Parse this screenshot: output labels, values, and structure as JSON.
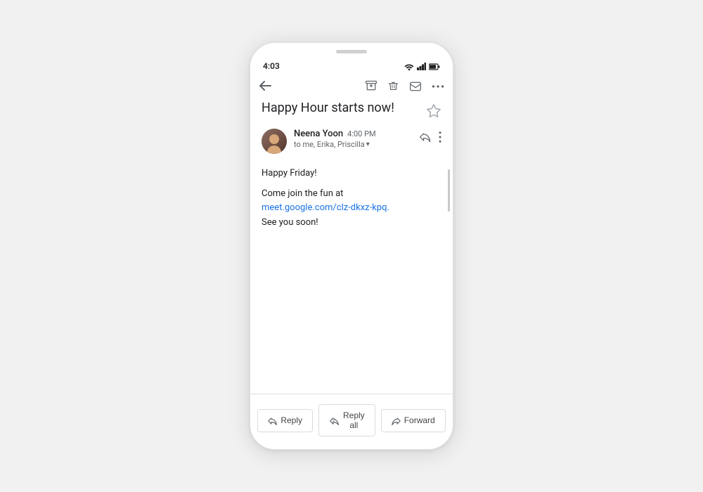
{
  "phone": {
    "status_bar": {
      "time": "4:03"
    },
    "toolbar": {
      "archive_label": "Archive",
      "delete_label": "Delete",
      "label_label": "Label",
      "more_label": "More"
    },
    "email": {
      "subject": "Happy Hour starts now!",
      "sender": {
        "name": "Neena Yoon",
        "time": "4:00 PM",
        "to": "to me, Erika, Priscilla"
      },
      "body_line1": "Happy Friday!",
      "body_line2": "Come join the fun at",
      "body_link": "meet.google.com/clz-dkxz-kpq.",
      "body_line3": "See you soon!"
    },
    "actions": {
      "reply_label": "Reply",
      "reply_all_label": "Reply all",
      "forward_label": "Forward"
    }
  }
}
